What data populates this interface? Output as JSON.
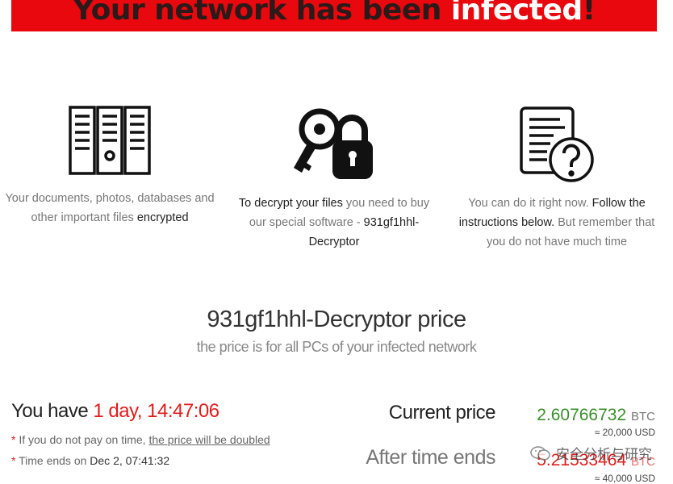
{
  "banner": {
    "title_dark": "Your network has been ",
    "title_highlight": "infected",
    "title_end": "!"
  },
  "features": [
    {
      "icon": "server-files-icon",
      "text_a": "Your documents, photos, databases and other important files ",
      "text_b": "encrypted"
    },
    {
      "icon": "key-lock-icon",
      "text_a": "To decrypt your files",
      "text_b": " you need to buy our special software - ",
      "text_c": "931gf1hhl-Decryptor"
    },
    {
      "icon": "document-question-icon",
      "text_a": "You can do it right now. ",
      "text_b": "Follow the instructions below.",
      "text_c": " But remember that you do not have much time"
    }
  ],
  "price": {
    "title": "931gf1hhl-Decryptor price",
    "subtitle": "the price is for all PCs of your infected network"
  },
  "timer": {
    "prefix": "You have ",
    "remaining": "1 day, 14:47:06"
  },
  "notes": {
    "note1_a": " If you do not pay on time, ",
    "note1_link": "the price will be doubled",
    "note2_a": " Time ends on ",
    "note2_b": "Dec 2, 07:41:32",
    "asterisk": "*"
  },
  "current_price": {
    "label": "Current price",
    "value": "2.60766732",
    "unit": "BTC",
    "usd": "≈ 20,000 USD"
  },
  "after_time": {
    "label": "After time ends",
    "value": "5.21533464",
    "unit": "BTC",
    "usd": "≈ 40,000 USD"
  },
  "watermark": {
    "text": "安全分析与研究"
  },
  "colors": {
    "banner_red": "#e8080d",
    "timer_red": "#e41b1b",
    "price_green": "#3a8f2a"
  }
}
